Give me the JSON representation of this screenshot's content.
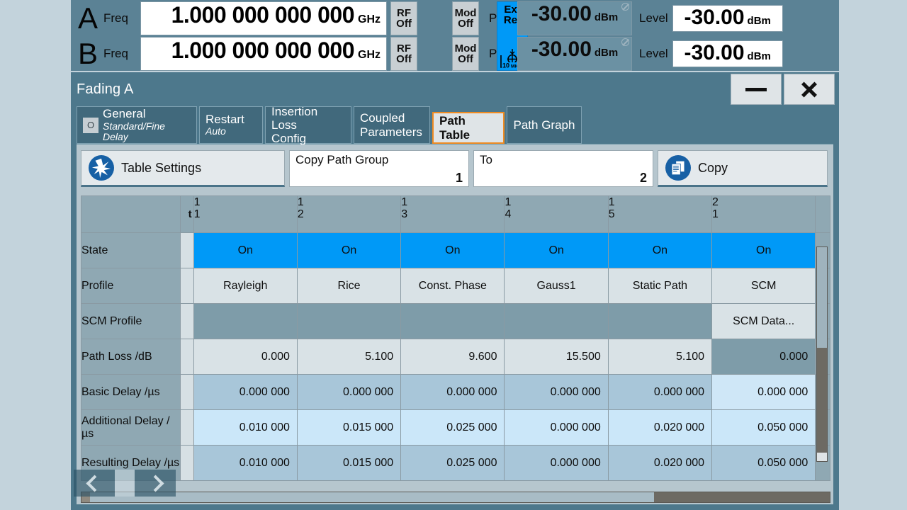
{
  "instrument": {
    "channels": [
      {
        "letter": "A",
        "freq_label": "Freq",
        "freq_value": "1.000 000 000 000",
        "freq_unit": "GHz",
        "rf_state": "RF\nOff",
        "rf_line1": "RF",
        "rf_line2": "Off",
        "mod_line1": "Mod",
        "mod_line2": "Off",
        "pep_label": "PEP",
        "pep_value": "-30.00",
        "pep_unit": "dBm",
        "level_label": "Level",
        "level_value": "-30.00",
        "level_unit": "dBm"
      },
      {
        "letter": "B",
        "freq_label": "Freq",
        "freq_value": "1.000 000 000 000",
        "freq_unit": "GHz",
        "rf_line1": "RF",
        "rf_line2": "Off",
        "mod_line1": "Mod",
        "mod_line2": "Off",
        "pep_label": "PEP",
        "pep_value": "-30.00",
        "pep_unit": "dBm",
        "level_label": "Level",
        "level_value": "-30.00",
        "level_unit": "dBm"
      }
    ],
    "ext_ref": {
      "line1": "Ext",
      "line2": "Ref",
      "freq": "10",
      "freq_unit": "MHz",
      "active_color": "#0099f7"
    }
  },
  "window": {
    "title": "Fading A",
    "minimize_label": "",
    "close_label": ""
  },
  "tabs": [
    {
      "id": "general",
      "badge": "O",
      "line1": "General",
      "line2": "Standard/Fine Delay",
      "active": false
    },
    {
      "id": "restart",
      "line1": "Restart",
      "line2": "Auto",
      "active": false
    },
    {
      "id": "insertion",
      "line1": "Insertion Loss",
      "line2": "Config",
      "active": false
    },
    {
      "id": "coupled",
      "line1": "Coupled",
      "line2": "Parameters",
      "active": false
    },
    {
      "id": "pathtable",
      "line1": "Path Table",
      "line2": "",
      "active": true
    },
    {
      "id": "pathgraph",
      "line1": "Path Graph",
      "line2": "",
      "active": false
    }
  ],
  "toolbar": {
    "table_settings_label": "Table Settings",
    "table_settings_icon": "star-burst-icon",
    "copy_path_group_label": "Copy Path Group",
    "copy_path_group_value": "1",
    "to_label": "To",
    "to_value": "2",
    "copy_label": "Copy",
    "copy_icon": "copy-documents-icon"
  },
  "table": {
    "corner_label": "t",
    "columns": [
      {
        "group": "1",
        "path": "1"
      },
      {
        "group": "1",
        "path": "2"
      },
      {
        "group": "1",
        "path": "3"
      },
      {
        "group": "1",
        "path": "4"
      },
      {
        "group": "1",
        "path": "5"
      },
      {
        "group": "2",
        "path": "1"
      }
    ],
    "rows": [
      {
        "label": "State",
        "values": [
          "On",
          "On",
          "On",
          "On",
          "On",
          "On"
        ]
      },
      {
        "label": "Profile",
        "values": [
          "Rayleigh",
          "Rice",
          "Const. Phase",
          "Gauss1",
          "Static Path",
          "SCM"
        ]
      },
      {
        "label": "SCM Profile",
        "values": [
          "",
          "",
          "",
          "",
          "",
          "SCM Data..."
        ]
      },
      {
        "label": "Path Loss /dB",
        "values": [
          "0.000",
          "5.100",
          "9.600",
          "15.500",
          "5.100",
          "0.000"
        ]
      },
      {
        "label": "Basic Delay /µs",
        "values": [
          "0.000 000",
          "0.000 000",
          "0.000 000",
          "0.000 000",
          "0.000 000",
          "0.000 000"
        ]
      },
      {
        "label": "Additional Delay /µs",
        "values": [
          "0.010 000",
          "0.015 000",
          "0.025 000",
          "0.000 000",
          "0.020 000",
          "0.050 000"
        ]
      },
      {
        "label": "Resulting Delay /µs",
        "values": [
          "0.010 000",
          "0.015 000",
          "0.025 000",
          "0.000 000",
          "0.020 000",
          "0.050 000"
        ]
      }
    ]
  },
  "scroll": {
    "left_arrow_icon": "chevron-left-icon",
    "right_arrow_icon": "chevron-right-icon"
  },
  "colors": {
    "accent_blue": "#0099f7",
    "tab_highlight": "#ef8b22",
    "window_bg": "#4d788c",
    "panel_bg": "#b6c6ce",
    "header_bg": "#5b8295"
  }
}
